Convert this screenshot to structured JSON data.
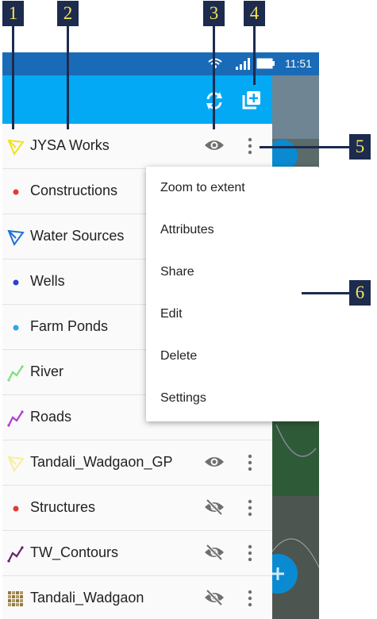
{
  "status_bar": {
    "time": "11:51"
  },
  "layers": [
    {
      "name": "JYSA Works",
      "icon": "polygon-icon",
      "color": "#f2e21f",
      "eye": "visible"
    },
    {
      "name": "Constructions",
      "icon": "point-icon",
      "color": "#e53935",
      "eye": "none"
    },
    {
      "name": "Water Sources",
      "icon": "polygon-icon",
      "color": "#1e6fd9",
      "eye": "none"
    },
    {
      "name": "Wells",
      "icon": "point-icon",
      "color": "#2b3fd6",
      "eye": "none"
    },
    {
      "name": "Farm Ponds",
      "icon": "point-icon",
      "color": "#29a7ef",
      "eye": "none"
    },
    {
      "name": "River",
      "icon": "line-icon",
      "color": "#7ee07e",
      "eye": "none"
    },
    {
      "name": "Roads",
      "icon": "line-icon",
      "color": "#b03bd8",
      "eye": "none"
    },
    {
      "name": "Tandali_Wadgaon_GP",
      "icon": "polygon-icon",
      "color": "#f6ef9a",
      "eye": "visible"
    },
    {
      "name": "Structures",
      "icon": "point-icon",
      "color": "#e53935",
      "eye": "hidden"
    },
    {
      "name": "TW_Contours",
      "icon": "line-icon",
      "color": "#6a1f6e",
      "eye": "hidden"
    },
    {
      "name": "Tandali_Wadgaon",
      "icon": "raster-icon",
      "color": "#b89a5a",
      "eye": "hidden"
    }
  ],
  "context_menu": {
    "items": [
      "Zoom to extent",
      "Attributes",
      "Share",
      "Edit",
      "Delete",
      "Settings"
    ]
  },
  "callouts": [
    "1",
    "2",
    "3",
    "4",
    "5",
    "6"
  ],
  "colors": {
    "app_bar": "#03a9f4",
    "status_bar": "#1a6bb7",
    "callout_bg": "#1c2b4e",
    "callout_text": "#f4e25a"
  }
}
